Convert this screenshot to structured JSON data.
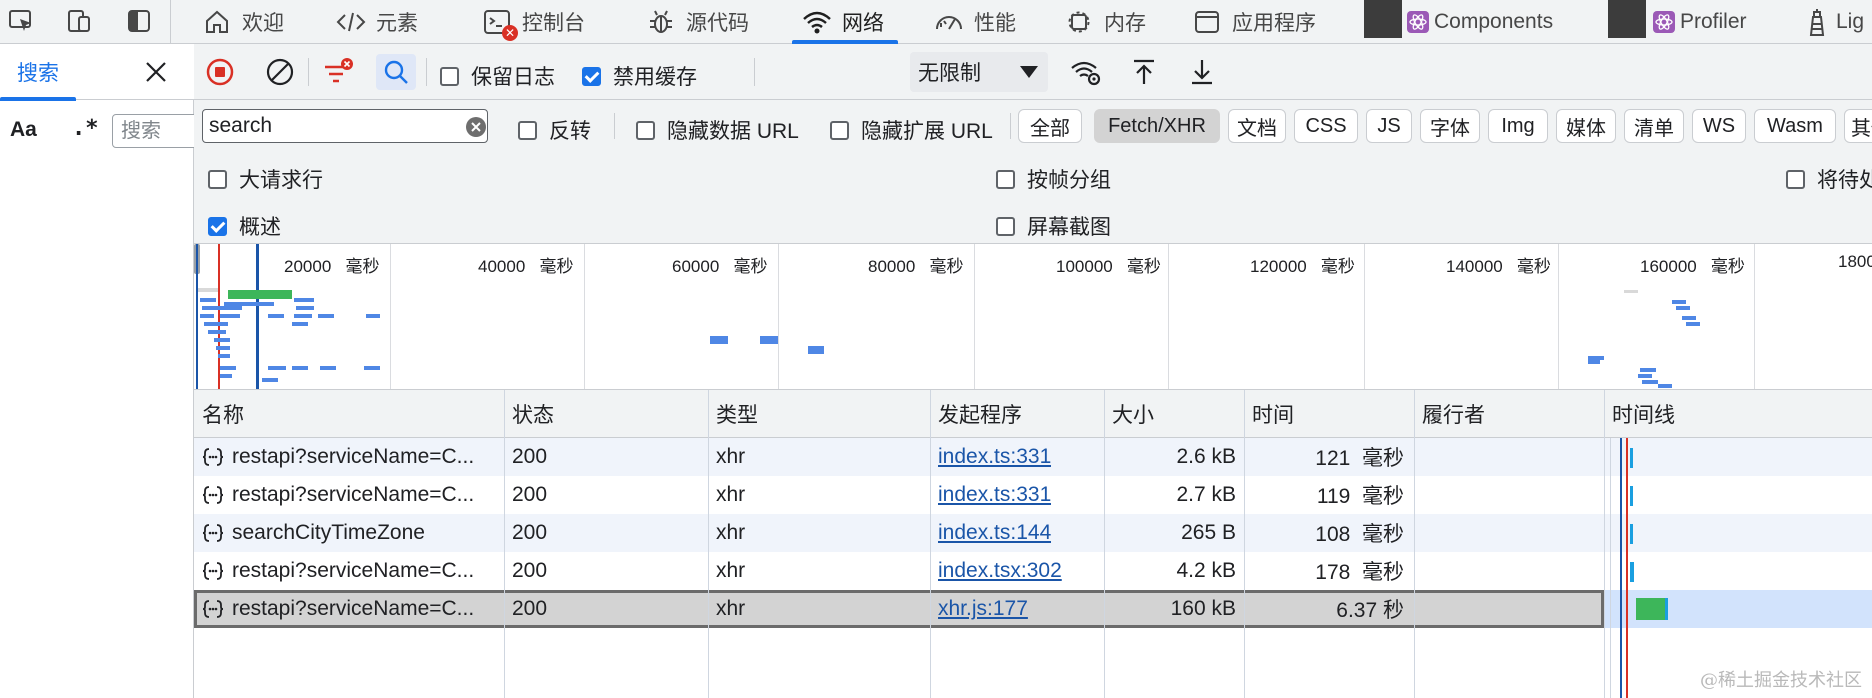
{
  "tabs": [
    {
      "label": "欢迎",
      "icon": "home-icon"
    },
    {
      "label": "元素",
      "icon": "code-icon"
    },
    {
      "label": "控制台",
      "icon": "console-icon"
    },
    {
      "label": "源代码",
      "icon": "bug-icon"
    },
    {
      "label": "网络",
      "icon": "wifi-icon",
      "active": true
    },
    {
      "label": "性能",
      "icon": "gauge-icon"
    },
    {
      "label": "内存",
      "icon": "chip-icon"
    },
    {
      "label": "应用程序",
      "icon": "window-icon"
    },
    {
      "label": "Components",
      "icon": "react-icon"
    },
    {
      "label": "Profiler",
      "icon": "react-icon"
    },
    {
      "label": "Lig",
      "icon": "lighthouse-icon"
    }
  ],
  "left_pane": {
    "tab_label": "搜索",
    "case_toggle": "Aa",
    "regex_toggle": ".*",
    "search_placeholder": "搜索"
  },
  "toolbar": {
    "preserve_log": {
      "label": "保留日志",
      "checked": false
    },
    "disable_cache": {
      "label": "禁用缓存",
      "checked": true
    },
    "throttle_value": "无限制"
  },
  "filter": {
    "value": "search",
    "invert_label": "反转",
    "hide_data_url_label": "隐藏数据 URL",
    "hide_ext_url_label": "隐藏扩展 URL",
    "types": [
      "全部",
      "Fetch/XHR",
      "文档",
      "CSS",
      "JS",
      "字体",
      "Img",
      "媒体",
      "清单",
      "WS",
      "Wasm",
      "其他"
    ],
    "active_type": "Fetch/XHR"
  },
  "options": {
    "big_rows": {
      "label": "大请求行",
      "checked": false
    },
    "group_by_frame": {
      "label": "按帧分组",
      "checked": false
    },
    "overview": {
      "label": "概述",
      "checked": true
    },
    "screenshots": {
      "label": "屏幕截图",
      "checked": false
    },
    "pending": {
      "label": "将待处理",
      "checked": false
    }
  },
  "overview_ticks": [
    {
      "value": "20000",
      "unit": "毫秒"
    },
    {
      "value": "40000",
      "unit": "毫秒"
    },
    {
      "value": "60000",
      "unit": "毫秒"
    },
    {
      "value": "80000",
      "unit": "毫秒"
    },
    {
      "value": "100000",
      "unit": "毫秒"
    },
    {
      "value": "120000",
      "unit": "毫秒"
    },
    {
      "value": "140000",
      "unit": "毫秒"
    },
    {
      "value": "160000",
      "unit": "毫秒"
    },
    {
      "value": "1800",
      "unit": ""
    }
  ],
  "columns": [
    "名称",
    "状态",
    "类型",
    "发起程序",
    "大小",
    "时间",
    "履行者",
    "时间线"
  ],
  "rows": [
    {
      "name": "restapi?serviceName=C...",
      "status": "200",
      "type": "xhr",
      "initiator": "index.ts:331",
      "size": "2.6 kB",
      "time": "121  毫秒"
    },
    {
      "name": "restapi?serviceName=C...",
      "status": "200",
      "type": "xhr",
      "initiator": "index.ts:331",
      "size": "2.7 kB",
      "time": "119  毫秒"
    },
    {
      "name": "searchCityTimeZone",
      "status": "200",
      "type": "xhr",
      "initiator": "index.ts:144",
      "size": "265 B",
      "time": "108  毫秒"
    },
    {
      "name": "restapi?serviceName=C...",
      "status": "200",
      "type": "xhr",
      "initiator": "index.tsx:302",
      "size": "4.2 kB",
      "time": "178  毫秒"
    },
    {
      "name": "restapi?serviceName=C...",
      "status": "200",
      "type": "xhr",
      "initiator": "xhr.js:177",
      "size": "160 kB",
      "time": "6.37 秒",
      "selected": true
    }
  ],
  "colors": {
    "accent": "#1a73e8",
    "record": "#d93025",
    "bar_blue": "#4f87e5",
    "bar_green": "#3db65a",
    "link": "#1a55a8"
  },
  "watermark": "@稀土掘金技术社区"
}
